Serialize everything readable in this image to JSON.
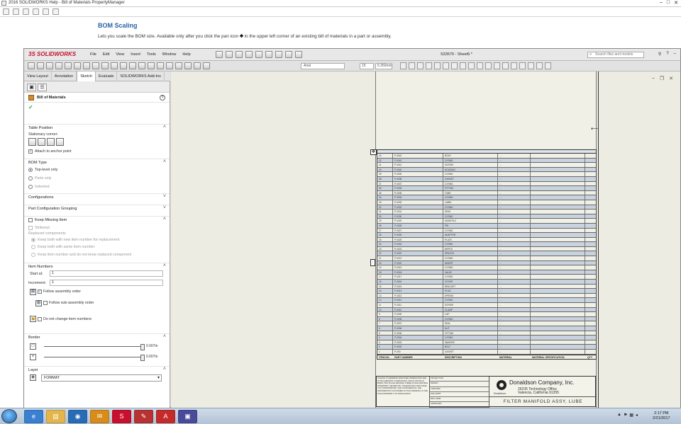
{
  "help": {
    "window_title": "2016 SOLIDWORKS Help - Bill of Materials PropertyManager",
    "heading": "BOM Scaling",
    "text_before": "Lets you scale the BOM size. Available only after you click the pan icon",
    "text_after": "in the upper left corner of an existing bill of materials in a part or assembly."
  },
  "app": {
    "logo": "3S SOLIDWORKS",
    "menu": [
      "File",
      "Edit",
      "View",
      "Insert",
      "Tools",
      "Window",
      "Help"
    ],
    "doc_title": "S33570 - Sheet5 *",
    "search_placeholder": "Search files and models",
    "font_name": "Arial",
    "font_size": "15",
    "font_height": "5.350mm"
  },
  "tabs": [
    "View Layout",
    "Annotation",
    "Sketch",
    "Evaluate",
    "SOLIDWORKS Add-Ins"
  ],
  "pm": {
    "title": "Bill of Materials",
    "table_position": "Table Position",
    "stationary_corner": "Stationary corner:",
    "attach_anchor": "Attach to anchor point",
    "bom_type": "BOM Type",
    "bom_types": [
      "Top-level only",
      "Parts only",
      "Indented"
    ],
    "configurations": "Configurations",
    "part_config_grouping": "Part Configuration Grouping",
    "keep_missing": "Keep Missing Item",
    "strikeout": "Strikeout",
    "replaced_components": "Replaced components",
    "replaced_opts": [
      "Keep both with new item number for replacement",
      "Keep both with same item number",
      "Keep item number and do not keep replaced component"
    ],
    "item_numbers": "Item Numbers",
    "start_at_label": "Start at:",
    "start_at_value": "1",
    "increment_label": "Increment:",
    "increment_value": "1",
    "follow_assembly": "Follow assembly order",
    "follow_sub": "Follow sub-assembly order",
    "do_not_change": "Do not change item numbers",
    "border": "Border",
    "border_val1": "0.007in",
    "border_val2": "0.007in",
    "layer": "Layer",
    "layer_value": "FORMAT"
  },
  "bom": {
    "rows": [
      [
        "1",
        "P-000",
        "GASKET",
        "..."
      ],
      [
        "2",
        "P-0002",
        "BOLT",
        "..."
      ],
      [
        "3",
        "P-0003",
        "WASHER",
        "..."
      ],
      [
        "4",
        "P-0004",
        "O-RING",
        "..."
      ],
      [
        "5",
        "P-0005",
        "FITTING",
        "..."
      ],
      [
        "6",
        "P-0006",
        "NUT",
        "..."
      ],
      [
        "7",
        "P-0007",
        "SEAL",
        "..."
      ],
      [
        "8",
        "P-0008",
        "O-RING",
        "..."
      ],
      [
        "9",
        "P-0009",
        "CAP",
        "..."
      ],
      [
        "10",
        "P-0010",
        "CLAMP",
        "..."
      ],
      [
        "11",
        "P-0011",
        "SCREW",
        "..."
      ],
      [
        "12",
        "P-0012",
        "O-RING",
        "..."
      ],
      [
        "13",
        "P-0013",
        "SPRING",
        "..."
      ],
      [
        "14",
        "P-0014",
        "PLUG",
        "..."
      ],
      [
        "15",
        "P-0015",
        "BRACKET",
        "..."
      ],
      [
        "16",
        "P-0016",
        "COVER",
        "..."
      ],
      [
        "17",
        "P-0017",
        "O-RING",
        "..."
      ],
      [
        "18",
        "P-0018",
        "VALVE",
        "..."
      ],
      [
        "19",
        "P-0019",
        "O-RING",
        "..."
      ],
      [
        "20",
        "P-0020",
        "INSERT",
        "..."
      ],
      [
        "21",
        "P-0021",
        "O-RING",
        "..."
      ],
      [
        "22",
        "P-0022",
        "SPACER",
        "..."
      ],
      [
        "23",
        "P-0023",
        "NIPPLE",
        "..."
      ],
      [
        "24",
        "P-0024",
        "O-RING",
        "..."
      ],
      [
        "25",
        "P-0025",
        "PLATE",
        "..."
      ],
      [
        "26",
        "P-0026",
        "ADAPTER",
        "..."
      ],
      [
        "27",
        "P-0027",
        "O-RING",
        "..."
      ],
      [
        "28",
        "P-0028",
        "PIN",
        "..."
      ],
      [
        "29",
        "P-0029",
        "MANIFOLD",
        "..."
      ],
      [
        "30",
        "P-0030",
        "O-RING",
        "..."
      ],
      [
        "31",
        "P-0031",
        "SHIM",
        "..."
      ],
      [
        "32",
        "P-0032",
        "O-RING",
        "..."
      ],
      [
        "33",
        "P-0033",
        "LABEL",
        "..."
      ],
      [
        "34",
        "P-0034",
        "O-RING",
        "..."
      ],
      [
        "35",
        "P-0035",
        "TUBE",
        "..."
      ],
      [
        "36",
        "P-0036",
        "FITTING",
        "..."
      ],
      [
        "37",
        "P-0037",
        "O-RING",
        "..."
      ],
      [
        "38",
        "P-0038",
        "GASKET",
        "..."
      ],
      [
        "39",
        "P-0039",
        "O-RING",
        "..."
      ],
      [
        "40",
        "P-0040",
        "HOUSING",
        "..."
      ],
      [
        "41",
        "P-0041",
        "SCREW",
        "..."
      ],
      [
        "42",
        "P-0042",
        "O-RING",
        "..."
      ],
      [
        "43",
        "P-0043",
        "BODY",
        "..."
      ]
    ],
    "footer": [
      "ITEM NO.",
      "PART NUMBER",
      "DESCRIPTION",
      "MATERIAL",
      "MATERIAL SPECIFICATION",
      "QTY"
    ]
  },
  "titleblock": {
    "company": "Donaldson Company, Inc.",
    "address1": "26235 Technology Office",
    "address2": "Valencia, California 91355",
    "logo_text": "Donaldson.",
    "part_title": "FILTER MANIFOLD ASSY, LUBE",
    "left_text": "UNLESS OTHERWISE SPECIFIED DIMENSIONS ARE IN MILLIMETERS TOLERANCES: ANGULAR MACH BEND TWO PLACE DECIMAL THREE PLACE DECIMAL INTERPRET GEOMETRIC TOLERANCING PER ASME Y14.5 PROPRIETARY AND CONFIDENTIAL THE INFORMATION CONTAINED IN THIS DRAWING IS THE SOLE PROPERTY OF DONALDSON",
    "mid": [
      "PROJECTION",
      "DRAWN",
      "CHECKED",
      "ENG APPR",
      "MFG APPR",
      "Q.A.",
      "APPROVED"
    ]
  },
  "taskbar": {
    "time": "2:17 PM",
    "date": "2/21/2017"
  }
}
